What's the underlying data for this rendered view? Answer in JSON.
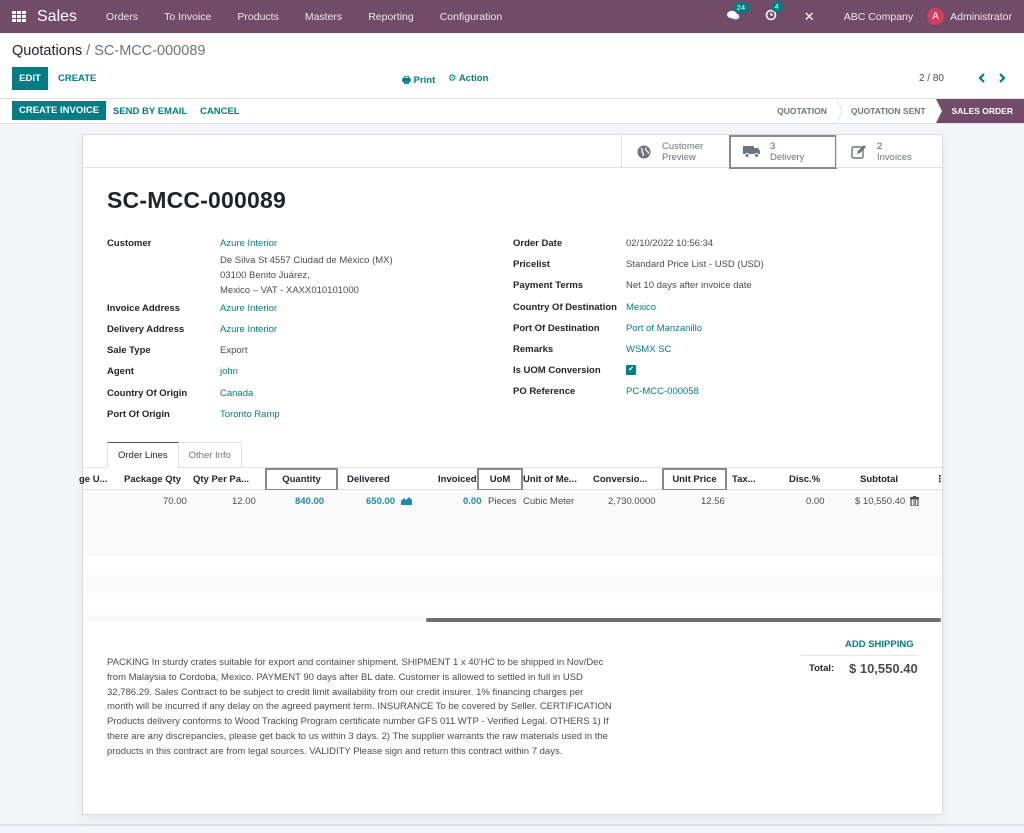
{
  "navbar": {
    "app_name": "Sales",
    "menu": [
      "Orders",
      "To Invoice",
      "Products",
      "Masters",
      "Reporting",
      "Configuration"
    ],
    "messages_badge": "24",
    "activities_badge": "4",
    "company": "ABC Company",
    "user_initial": "A",
    "user_name": "Administrator",
    "brand_color": "#714b67"
  },
  "control_panel": {
    "breadcrumb_parent": "Quotations",
    "breadcrumb_separator": " / ",
    "breadcrumb_current": "SC-MCC-000089",
    "edit_label": "EDIT",
    "create_label": "CREATE",
    "print_label": "Print",
    "action_label": "Action",
    "pager": "2 / 80",
    "prev_icon": "‹",
    "next_icon": "›"
  },
  "statusbar": {
    "create_invoice_label": "CREATE INVOICE",
    "send_email_label": "SEND BY EMAIL",
    "cancel_label": "CANCEL",
    "stages": [
      "QUOTATION",
      "QUOTATION SENT",
      "SALES ORDER"
    ],
    "active_stage": "SALES ORDER"
  },
  "smart_buttons": {
    "preview": {
      "line1": "Customer",
      "line2": "Preview"
    },
    "delivery": {
      "count": "3",
      "label": "Delivery"
    },
    "invoices": {
      "count": "2",
      "label": "Invoices"
    }
  },
  "form": {
    "title": "SC-MCC-000089",
    "left": {
      "customer_label": "Customer",
      "customer": "Azure Interior",
      "address_line1": "De Silva St 4557 Ciudad de México (MX)",
      "address_line2": "03100 Benito Juárez,",
      "address_line3": "Mexico – VAT - XAXX010101000",
      "invoice_address_label": "Invoice Address",
      "invoice_address": "Azure Interior",
      "delivery_address_label": "Delivery Address",
      "delivery_address": "Azure Interior",
      "sale_type_label": "Sale Type",
      "sale_type": "Export",
      "agent_label": "Agent",
      "agent": "john",
      "country_origin_label": "Country Of Origin",
      "country_origin": "Canada",
      "port_origin_label": "Port Of Origin",
      "port_origin": "Toronto Ramp"
    },
    "right": {
      "order_date_label": "Order Date",
      "order_date": "02/10/2022 10:56:34",
      "pricelist_label": "Pricelist",
      "pricelist": "Standard Price List - USD (USD)",
      "payment_terms_label": "Payment Terms",
      "payment_terms": "Net 10 days after invoice date",
      "country_dest_label": "Country Of Destination",
      "country_dest": "Mexico",
      "port_dest_label": "Port Of Destination",
      "port_dest": "Port of Manzanillo",
      "remarks_label": "Remarks",
      "remarks": "WSMX SC",
      "uom_conversion_label": "Is UOM Conversion",
      "uom_conversion_checked": true,
      "po_reference_label": "PO Reference",
      "po_reference": "PC-MCC-000058"
    }
  },
  "notebook": {
    "tabs": [
      "Order Lines",
      "Other Info"
    ],
    "active_tab": "Order Lines",
    "columns": [
      "ge U...",
      "Package Qty",
      "Qty Per Pa...",
      "Quantity",
      "Delivered",
      "Invoiced",
      "UoM",
      "Unit of Me...",
      "Conversio...",
      "Unit Price",
      "Tax...",
      "Disc.%",
      "Subtotal"
    ],
    "rows": [
      {
        "package_qty": "70.00",
        "qty_per_package": "12.00",
        "quantity": "840.00",
        "delivered": "650.00",
        "invoiced": "0.00",
        "uom": "Pieces",
        "unit_of_measure": "Cubic Meter",
        "conversion": "2,730.0000",
        "unit_price": "12.56",
        "taxes": "",
        "discount": "0.00",
        "subtotal": "$ 10,550.40"
      }
    ]
  },
  "totals": {
    "add_shipping_label": "ADD SHIPPING",
    "total_label": "Total:",
    "total_value": "$ 10,550.40"
  },
  "notes": "PACKING In sturdy crates suitable for export and container shipment. SHIPMENT 1 x 40'HC to be shipped in Nov/Dec from Malaysia to Cordoba, Mexico. PAYMENT 90 days after BL date. Customer is allowed to settled in full in USD 32,786.29. Sales Contract to be subject to credit limit availability from our credit insurer. 1% financing charges per month will be incurred if any delay on the agreed payment term. INSURANCE To be covered by Seller. CERTIFICATION Products delivery conforms to Wood Tracking Program certificate number GFS 011 WTP - Verified Legal. OTHERS 1) If there are any discrepancies, please get back to us within 3 days. 2) The supplier warrants the raw materials used in the products in this contract are from legal sources. VALIDITY Please sign and return this contract within 7 days."
}
